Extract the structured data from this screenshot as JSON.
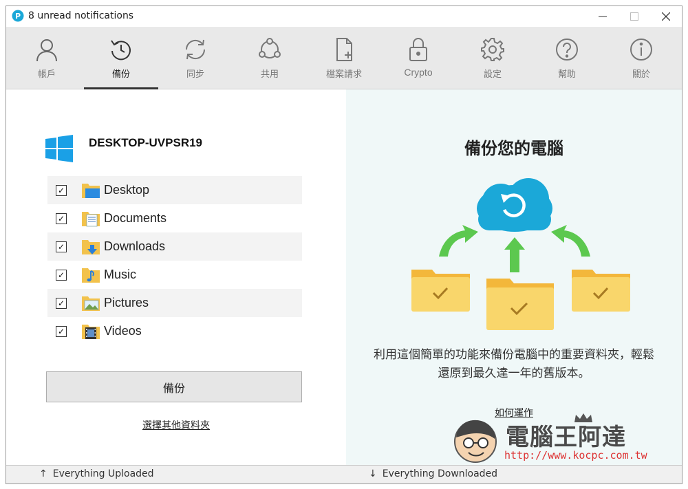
{
  "window": {
    "title": "8 unread notifications",
    "controls": {
      "minimize": "—",
      "maximize": "☐",
      "close": "✕"
    }
  },
  "toolbar": {
    "items": [
      {
        "label": "帳戶",
        "icon": "user-icon"
      },
      {
        "label": "備份",
        "icon": "backup-icon",
        "active": true
      },
      {
        "label": "同步",
        "icon": "sync-icon"
      },
      {
        "label": "共用",
        "icon": "share-icon"
      },
      {
        "label": "檔案請求",
        "icon": "file-request-icon"
      },
      {
        "label": "Crypto",
        "icon": "lock-icon"
      },
      {
        "label": "設定",
        "icon": "gear-icon"
      },
      {
        "label": "幫助",
        "icon": "help-icon"
      },
      {
        "label": "關於",
        "icon": "info-icon"
      }
    ]
  },
  "left": {
    "computer_name": "DESKTOP-UVPSR19",
    "folders": [
      {
        "name": "Desktop",
        "checked": true
      },
      {
        "name": "Documents",
        "checked": true
      },
      {
        "name": "Downloads",
        "checked": true
      },
      {
        "name": "Music",
        "checked": true
      },
      {
        "name": "Pictures",
        "checked": true
      },
      {
        "name": "Videos",
        "checked": true
      }
    ],
    "backup_button": "備份",
    "other_folders_link": "選擇其他資料夾"
  },
  "right": {
    "title": "備份您的電腦",
    "description": "利用這個簡單的功能來備份電腦中的重要資料夾，輕鬆還原到最久達一年的舊版本。",
    "how_link": "如何運作",
    "watermark_text": "電腦王阿達",
    "watermark_url": "http://www.kocpc.com.tw"
  },
  "status": {
    "uploaded": "Everything Uploaded",
    "downloaded": "Everything Downloaded"
  },
  "colors": {
    "accent": "#1ba8d8",
    "folder": "#f7cf5a",
    "arrow_green": "#5cc84f",
    "toolbar_bg": "#e9e9e9",
    "right_bg": "#f0f8f8"
  }
}
